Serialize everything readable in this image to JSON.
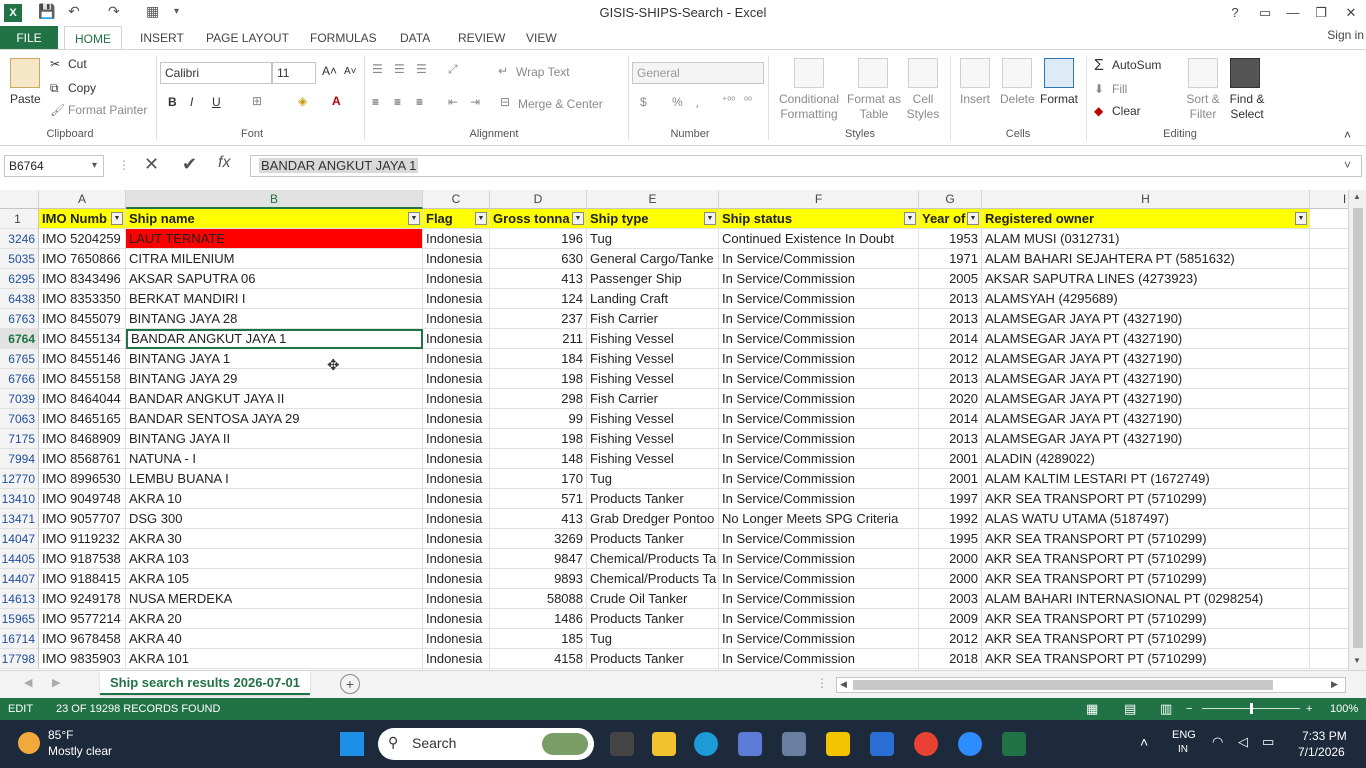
{
  "window": {
    "title": "GISIS-SHIPS-Search - Excel",
    "app_icon": "X",
    "help": "?",
    "minimize": "—",
    "restore": "❐",
    "close": "✕"
  },
  "ribbon_tabs": {
    "file": "FILE",
    "tabs": [
      "HOME",
      "INSERT",
      "PAGE LAYOUT",
      "FORMULAS",
      "DATA",
      "REVIEW",
      "VIEW"
    ],
    "sign_in": "Sign in"
  },
  "ribbon": {
    "clipboard": {
      "paste": "Paste",
      "cut": "Cut",
      "copy": "Copy",
      "format_painter": "Format Painter",
      "label": "Clipboard"
    },
    "font": {
      "name": "Calibri",
      "size": "11",
      "bold": "B",
      "italic": "I",
      "underline": "U",
      "label": "Font"
    },
    "alignment": {
      "wrap_text": "Wrap Text",
      "merge_center": "Merge & Center",
      "label": "Alignment"
    },
    "number": {
      "format": "General",
      "currency": "$",
      "percent": "%",
      "comma": "⸴",
      "label": "Number"
    },
    "styles": {
      "conditional": "Conditional Formatting",
      "format_table": "Format as Table",
      "cell_styles": "Cell Styles",
      "label": "Styles"
    },
    "cells": {
      "insert": "Insert",
      "delete": "Delete",
      "format": "Format",
      "label": "Cells"
    },
    "editing": {
      "autosum": "AutoSum",
      "fill": "Fill",
      "clear": "Clear",
      "sort_filter": "Sort & Filter",
      "find_select": "Find & Select",
      "label": "Editing"
    }
  },
  "formula_bar": {
    "name_box": "B6764",
    "fx": "fx",
    "value": "BANDAR ANGKUT JAYA 1"
  },
  "columns": [
    "A",
    "B",
    "C",
    "D",
    "E",
    "F",
    "G",
    "H",
    "I"
  ],
  "header_row": {
    "row_num": "1",
    "cells": [
      "IMO Numb",
      "Ship name",
      "Flag",
      "Gross tonna",
      "Ship type",
      "Ship status",
      "Year of",
      "Registered owner"
    ]
  },
  "rows": [
    {
      "n": "3246",
      "imo": "IMO 5204259",
      "name": "LAUT TERNATE",
      "flag": "Indonesia",
      "gt": "196",
      "type": "Tug",
      "status": "Continued Existence In Doubt",
      "year": "1953",
      "owner": "ALAM MUSI (0312731)"
    },
    {
      "n": "5035",
      "imo": "IMO 7650866",
      "name": "CITRA MILENIUM",
      "flag": "Indonesia",
      "gt": "630",
      "type": "General Cargo/Tanke",
      "status": "In Service/Commission",
      "year": "1971",
      "owner": "ALAM BAHARI SEJAHTERA PT (5851632)"
    },
    {
      "n": "6295",
      "imo": "IMO 8343496",
      "name": "AKSAR SAPUTRA 06",
      "flag": "Indonesia",
      "gt": "413",
      "type": "Passenger Ship",
      "status": "In Service/Commission",
      "year": "2005",
      "owner": "AKSAR SAPUTRA LINES (4273923)"
    },
    {
      "n": "6438",
      "imo": "IMO 8353350",
      "name": "BERKAT MANDIRI I",
      "flag": "Indonesia",
      "gt": "124",
      "type": "Landing Craft",
      "status": "In Service/Commission",
      "year": "2013",
      "owner": "ALAMSYAH (4295689)"
    },
    {
      "n": "6763",
      "imo": "IMO 8455079",
      "name": "BINTANG JAYA 28",
      "flag": "Indonesia",
      "gt": "237",
      "type": "Fish Carrier",
      "status": "In Service/Commission",
      "year": "2013",
      "owner": "ALAMSEGAR JAYA PT (4327190)"
    },
    {
      "n": "6764",
      "imo": "IMO 8455134",
      "name": "BANDAR ANGKUT JAYA 1",
      "flag": "Indonesia",
      "gt": "211",
      "type": "Fishing Vessel",
      "status": "In Service/Commission",
      "year": "2014",
      "owner": "ALAMSEGAR JAYA PT (4327190)"
    },
    {
      "n": "6765",
      "imo": "IMO 8455146",
      "name": "BINTANG JAYA 1",
      "flag": "Indonesia",
      "gt": "184",
      "type": "Fishing Vessel",
      "status": "In Service/Commission",
      "year": "2012",
      "owner": "ALAMSEGAR JAYA PT (4327190)"
    },
    {
      "n": "6766",
      "imo": "IMO 8455158",
      "name": "BINTANG JAYA 29",
      "flag": "Indonesia",
      "gt": "198",
      "type": "Fishing Vessel",
      "status": "In Service/Commission",
      "year": "2013",
      "owner": "ALAMSEGAR JAYA PT (4327190)"
    },
    {
      "n": "7039",
      "imo": "IMO 8464044",
      "name": "BANDAR ANGKUT JAYA II",
      "flag": "Indonesia",
      "gt": "298",
      "type": "Fish Carrier",
      "status": "In Service/Commission",
      "year": "2020",
      "owner": "ALAMSEGAR JAYA PT (4327190)"
    },
    {
      "n": "7063",
      "imo": "IMO 8465165",
      "name": "BANDAR SENTOSA JAYA 29",
      "flag": "Indonesia",
      "gt": "99",
      "type": "Fishing Vessel",
      "status": "In Service/Commission",
      "year": "2014",
      "owner": "ALAMSEGAR JAYA PT (4327190)"
    },
    {
      "n": "7175",
      "imo": "IMO 8468909",
      "name": "BINTANG JAYA II",
      "flag": "Indonesia",
      "gt": "198",
      "type": "Fishing Vessel",
      "status": "In Service/Commission",
      "year": "2013",
      "owner": "ALAMSEGAR JAYA PT (4327190)"
    },
    {
      "n": "7994",
      "imo": "IMO 8568761",
      "name": "NATUNA - I",
      "flag": "Indonesia",
      "gt": "148",
      "type": "Fishing Vessel",
      "status": "In Service/Commission",
      "year": "2001",
      "owner": "ALADIN (4289022)"
    },
    {
      "n": "12770",
      "imo": "IMO 8996530",
      "name": "LEMBU BUANA I",
      "flag": "Indonesia",
      "gt": "170",
      "type": "Tug",
      "status": "In Service/Commission",
      "year": "2001",
      "owner": "ALAM KALTIM LESTARI PT (1672749)"
    },
    {
      "n": "13410",
      "imo": "IMO 9049748",
      "name": "AKRA 10",
      "flag": "Indonesia",
      "gt": "571",
      "type": "Products Tanker",
      "status": "In Service/Commission",
      "year": "1997",
      "owner": "AKR SEA TRANSPORT PT (5710299)"
    },
    {
      "n": "13471",
      "imo": "IMO 9057707",
      "name": "DSG 300",
      "flag": "Indonesia",
      "gt": "413",
      "type": "Grab Dredger Pontoo",
      "status": "No Longer Meets SPG Criteria",
      "year": "1992",
      "owner": "ALAS WATU UTAMA (5187497)"
    },
    {
      "n": "14047",
      "imo": "IMO 9119232",
      "name": "AKRA 30",
      "flag": "Indonesia",
      "gt": "3269",
      "type": "Products Tanker",
      "status": "In Service/Commission",
      "year": "1995",
      "owner": "AKR SEA TRANSPORT PT (5710299)"
    },
    {
      "n": "14405",
      "imo": "IMO 9187538",
      "name": "AKRA 103",
      "flag": "Indonesia",
      "gt": "9847",
      "type": "Chemical/Products Ta",
      "status": "In Service/Commission",
      "year": "2000",
      "owner": "AKR SEA TRANSPORT PT (5710299)"
    },
    {
      "n": "14407",
      "imo": "IMO 9188415",
      "name": "AKRA 105",
      "flag": "Indonesia",
      "gt": "9893",
      "type": "Chemical/Products Ta",
      "status": "In Service/Commission",
      "year": "2000",
      "owner": "AKR SEA TRANSPORT PT (5710299)"
    },
    {
      "n": "14613",
      "imo": "IMO 9249178",
      "name": "NUSA MERDEKA",
      "flag": "Indonesia",
      "gt": "58088",
      "type": "Crude Oil Tanker",
      "status": "In Service/Commission",
      "year": "2003",
      "owner": "ALAM BAHARI INTERNASIONAL PT (0298254)"
    },
    {
      "n": "15965",
      "imo": "IMO 9577214",
      "name": "AKRA 20",
      "flag": "Indonesia",
      "gt": "1486",
      "type": "Products Tanker",
      "status": "In Service/Commission",
      "year": "2009",
      "owner": "AKR SEA TRANSPORT PT (5710299)"
    },
    {
      "n": "16714",
      "imo": "IMO 9678458",
      "name": "AKRA 40",
      "flag": "Indonesia",
      "gt": "185",
      "type": "Tug",
      "status": "In Service/Commission",
      "year": "2012",
      "owner": "AKR SEA TRANSPORT PT (5710299)"
    },
    {
      "n": "17798",
      "imo": "IMO 9835903",
      "name": "AKRA 101",
      "flag": "Indonesia",
      "gt": "4158",
      "type": "Products Tanker",
      "status": "In Service/Commission",
      "year": "2018",
      "owner": "AKR SEA TRANSPORT PT (5710299)"
    }
  ],
  "sheet": {
    "tab_name": "Ship search results 2026-07-01",
    "add_icon": "+"
  },
  "status_bar": {
    "mode": "EDIT",
    "message": "23 OF 19298 RECORDS FOUND",
    "zoom": "100%"
  },
  "taskbar": {
    "weather_temp": "85°F",
    "weather_desc": "Mostly clear",
    "search_label": "Search",
    "lang": "ENG",
    "lang_sub": "IN",
    "time": "7:33 PM",
    "date": "7/1/2026"
  },
  "colors": {
    "excel_green": "#217346",
    "header_yellow": "#ffff00",
    "flag_red": "#ff0000",
    "taskbar": "#1c2a3c"
  }
}
